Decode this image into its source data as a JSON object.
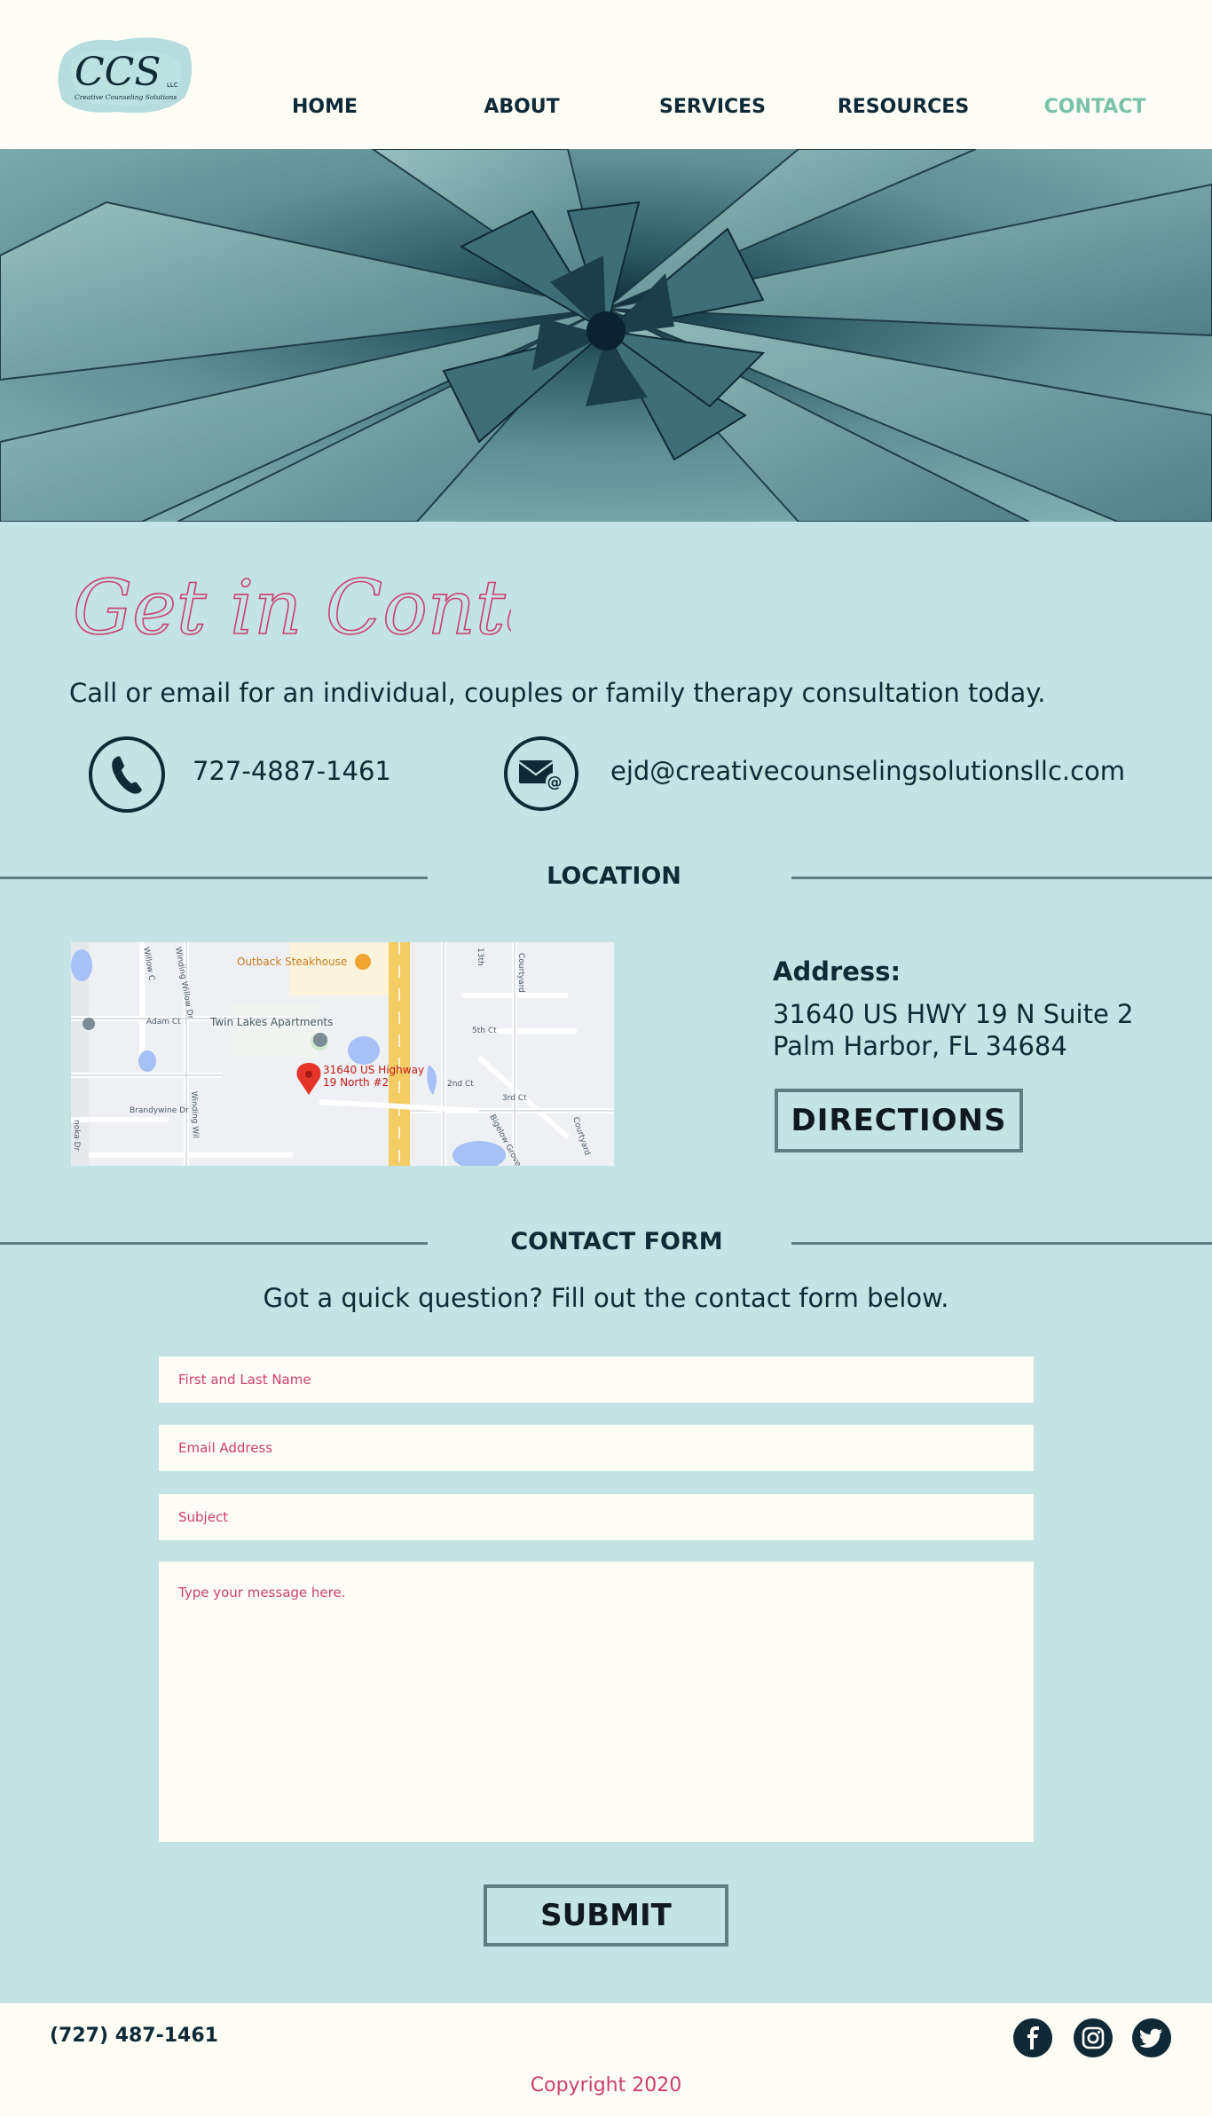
{
  "header": {
    "logo_text": "CCS",
    "logo_llc": "LLC",
    "logo_tagline": "Creative Counseling Solutions",
    "nav": [
      {
        "label": "HOME",
        "active": false
      },
      {
        "label": "ABOUT",
        "active": false
      },
      {
        "label": "SERVICES",
        "active": false
      },
      {
        "label": "RESOURCES",
        "active": false
      },
      {
        "label": "CONTACT",
        "active": true
      }
    ]
  },
  "contact": {
    "title": "Get in Contact",
    "intro": "Call or email for an individual, couples or family therapy consultation today.",
    "phone": "727-4887-1461",
    "email": "ejd@creativecounselingsolutionsllc.com",
    "phone_icon": "phone-icon",
    "email_icon": "email-icon"
  },
  "location": {
    "section_title": "LOCATION",
    "map": {
      "labels": {
        "restaurant": "Outback Steakhouse",
        "apartments": "Twin Lakes Apartments",
        "pin_line1": "31640 US Highway",
        "pin_line2": "19 North #2",
        "adam": "Adam Ct",
        "brandywine": "Brandywine Dr",
        "winding1": "Winding Willow Dr",
        "winding2": "Winding Wil",
        "willow": "Willow C",
        "fifth": "5th Ct",
        "second": "2nd Ct",
        "third": "3rd Ct",
        "thirteenth": "13th",
        "courtyard1": "Courtyard",
        "courtyard2": "Courtyard",
        "bigelow": "Bigelow Grove Blvd",
        "okanoka": "noka Dr"
      }
    },
    "address_label": "Address:",
    "address_line1": "31640 US HWY 19 N Suite 2",
    "address_line2": "Palm Harbor, FL 34684",
    "directions_label": "DIRECTIONS"
  },
  "form": {
    "section_title": "CONTACT FORM",
    "intro": "Got a quick question? Fill out the contact form below.",
    "name_placeholder": "First and Last Name",
    "email_placeholder": "Email Address",
    "subject_placeholder": "Subject",
    "message_placeholder": "Type your message here.",
    "submit_label": "SUBMIT"
  },
  "footer": {
    "phone": "(727) 487-1461",
    "copyright": "Copyright 2020",
    "social": [
      "facebook-icon",
      "instagram-icon",
      "twitter-icon"
    ]
  },
  "colors": {
    "header_bg": "#fdfdf6",
    "page_bg": "#c4e3e4",
    "navy": "#0f2a36",
    "active_nav": "#7bc2aa",
    "accent_pink": "#cc3f6e",
    "divider": "#5e7f82"
  }
}
